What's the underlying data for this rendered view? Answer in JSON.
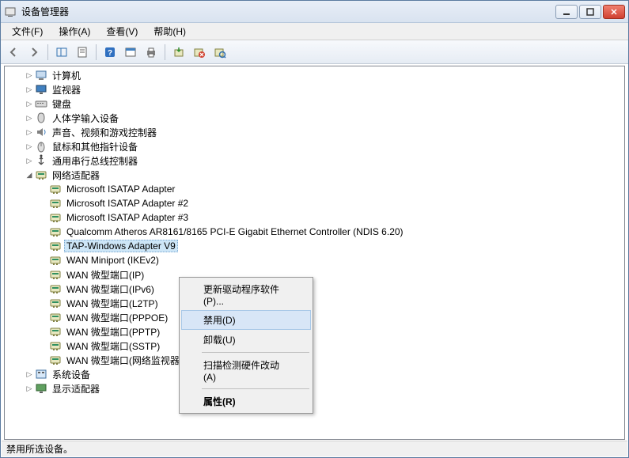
{
  "window": {
    "title": "设备管理器"
  },
  "menu": {
    "file": "文件(F)",
    "action": "操作(A)",
    "view": "查看(V)",
    "help": "帮助(H)"
  },
  "toolbar_icons": {
    "back": "back-icon",
    "forward": "forward-icon",
    "show_hide": "show-hide-icon",
    "properties": "properties-icon",
    "help": "help-icon",
    "view_icon": "view-icon",
    "print": "print-icon",
    "update": "update-icon",
    "disable": "disable-icon",
    "uninstall": "scan-icon"
  },
  "tree": [
    {
      "depth": 1,
      "exp": "closed",
      "icon": "computer-icon",
      "label": "计算机"
    },
    {
      "depth": 1,
      "exp": "closed",
      "icon": "monitor-icon",
      "label": "监视器"
    },
    {
      "depth": 1,
      "exp": "closed",
      "icon": "keyboard-icon",
      "label": "键盘"
    },
    {
      "depth": 1,
      "exp": "closed",
      "icon": "hid-icon",
      "label": "人体学输入设备"
    },
    {
      "depth": 1,
      "exp": "closed",
      "icon": "audio-icon",
      "label": "声音、视频和游戏控制器"
    },
    {
      "depth": 1,
      "exp": "closed",
      "icon": "mouse-icon",
      "label": "鼠标和其他指针设备"
    },
    {
      "depth": 1,
      "exp": "closed",
      "icon": "usb-icon",
      "label": "通用串行总线控制器"
    },
    {
      "depth": 1,
      "exp": "open",
      "icon": "network-icon",
      "label": "网络适配器"
    },
    {
      "depth": 2,
      "exp": "none",
      "icon": "adapter-icon",
      "label": "Microsoft ISATAP Adapter"
    },
    {
      "depth": 2,
      "exp": "none",
      "icon": "adapter-icon",
      "label": "Microsoft ISATAP Adapter #2"
    },
    {
      "depth": 2,
      "exp": "none",
      "icon": "adapter-icon",
      "label": "Microsoft ISATAP Adapter #3"
    },
    {
      "depth": 2,
      "exp": "none",
      "icon": "adapter-icon",
      "label": "Qualcomm Atheros AR8161/8165 PCI-E Gigabit Ethernet Controller (NDIS 6.20)"
    },
    {
      "depth": 2,
      "exp": "none",
      "icon": "adapter-icon",
      "label": "TAP-Windows Adapter V9",
      "selected": true
    },
    {
      "depth": 2,
      "exp": "none",
      "icon": "adapter-icon",
      "label": "WAN Miniport (IKEv2)"
    },
    {
      "depth": 2,
      "exp": "none",
      "icon": "adapter-icon",
      "label": "WAN 微型端口(IP)"
    },
    {
      "depth": 2,
      "exp": "none",
      "icon": "adapter-icon",
      "label": "WAN 微型端口(IPv6)"
    },
    {
      "depth": 2,
      "exp": "none",
      "icon": "adapter-icon",
      "label": "WAN 微型端口(L2TP)"
    },
    {
      "depth": 2,
      "exp": "none",
      "icon": "adapter-icon",
      "label": "WAN 微型端口(PPPOE)"
    },
    {
      "depth": 2,
      "exp": "none",
      "icon": "adapter-icon",
      "label": "WAN 微型端口(PPTP)"
    },
    {
      "depth": 2,
      "exp": "none",
      "icon": "adapter-icon",
      "label": "WAN 微型端口(SSTP)"
    },
    {
      "depth": 2,
      "exp": "none",
      "icon": "adapter-icon",
      "label": "WAN 微型端口(网络监视器)"
    },
    {
      "depth": 1,
      "exp": "closed",
      "icon": "system-icon",
      "label": "系统设备"
    },
    {
      "depth": 1,
      "exp": "closed",
      "icon": "display-icon",
      "label": "显示适配器"
    }
  ],
  "context_menu": {
    "update_driver": "更新驱动程序软件(P)...",
    "disable": "禁用(D)",
    "uninstall": "卸载(U)",
    "scan": "扫描检测硬件改动(A)",
    "properties": "属性(R)"
  },
  "status": "禁用所选设备。",
  "colors": {
    "selection": "#cde6f7",
    "menu_hover": "#d8e6f7"
  }
}
